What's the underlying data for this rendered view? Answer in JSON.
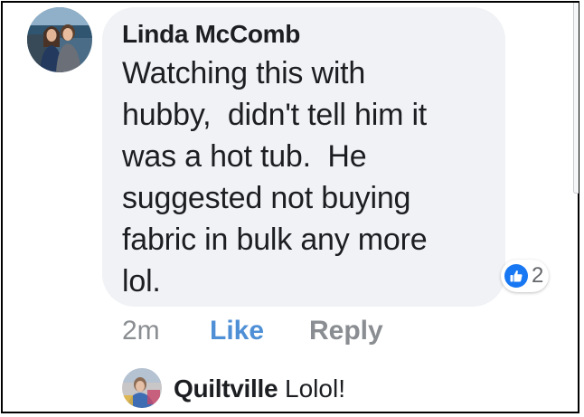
{
  "comment": {
    "author": "Linda McComb",
    "lines": [
      "Watching this with",
      "hubby,  didn't tell him it",
      "was a hot tub.  He",
      "suggested not buying",
      "fabric in bulk any more",
      "lol."
    ],
    "reaction": {
      "icon": "thumbs-up-icon",
      "count": "2",
      "color": "#1877f2"
    },
    "time": "2m",
    "like_label": "Like",
    "reply_label": "Reply",
    "like_color": "#4e8fd6"
  },
  "reply": {
    "author": "Quiltville",
    "text": "Lolol!"
  }
}
